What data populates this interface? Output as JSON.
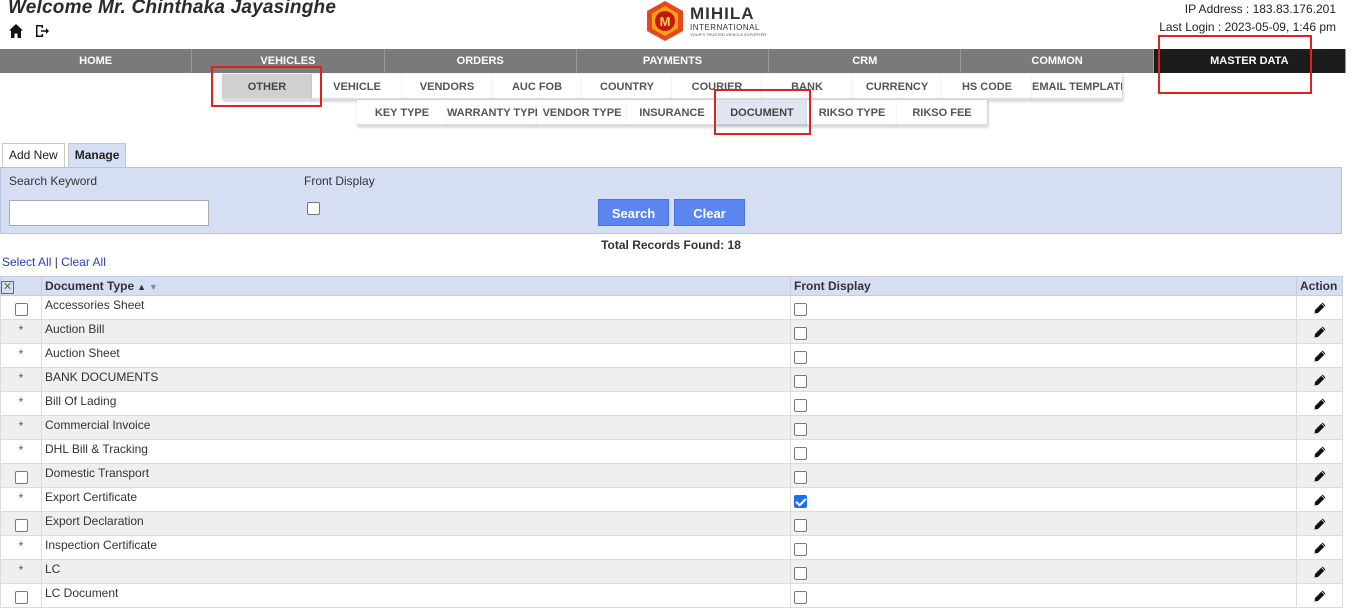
{
  "header": {
    "welcome": "Welcome Mr. Chinthaka Jayasinghe",
    "ip": "IP Address : 183.83.176.201",
    "last_login": "Last Login : 2023-05-09, 1:46 pm",
    "logo_name": "MIHILA",
    "logo_sub": "INTERNATIONAL",
    "logo_tag": "YOUR'S TRUSTED VEHICLE EXPORTER",
    "logo_letter": "M"
  },
  "mainnav": [
    "HOME",
    "VEHICLES",
    "ORDERS",
    "PAYMENTS",
    "CRM",
    "COMMON",
    "MASTER DATA"
  ],
  "subnav_row1": [
    "OTHER",
    "VEHICLE",
    "VENDORS",
    "AUC FOB",
    "COUNTRY",
    "COURIER",
    "BANK",
    "CURRENCY",
    "HS CODE",
    "EMAIL TEMPLATE"
  ],
  "subnav_row2": [
    "KEY TYPE",
    "WARRANTY TYPE",
    "VENDOR TYPE",
    "INSURANCE",
    "DOCUMENT",
    "RIKSO TYPE",
    "RIKSO FEE"
  ],
  "tabs": [
    "Add New",
    "Manage"
  ],
  "search": {
    "keyword_label": "Search Keyword",
    "front_display_label": "Front Display",
    "keyword_value": "",
    "search_button": "Search",
    "clear_button": "Clear"
  },
  "total_records": "Total Records Found: 18",
  "select_all": "Select All",
  "separator": "|",
  "clear_all": "Clear All",
  "table": {
    "headers": [
      "Document Type",
      "Front Display",
      "Action"
    ],
    "rows": [
      {
        "name": "Accessories Sheet",
        "marker": "checkbox",
        "front": false
      },
      {
        "name": "Auction Bill",
        "marker": "*",
        "front": false
      },
      {
        "name": "Auction Sheet",
        "marker": "*",
        "front": false
      },
      {
        "name": "BANK DOCUMENTS",
        "marker": "*",
        "front": false
      },
      {
        "name": "Bill Of Lading",
        "marker": "*",
        "front": false
      },
      {
        "name": "Commercial Invoice",
        "marker": "*",
        "front": false
      },
      {
        "name": "DHL Bill & Tracking",
        "marker": "*",
        "front": false
      },
      {
        "name": "Domestic Transport",
        "marker": "checkbox",
        "front": false
      },
      {
        "name": "Export Certificate",
        "marker": "*",
        "front": true
      },
      {
        "name": "Export Declaration",
        "marker": "checkbox",
        "front": false
      },
      {
        "name": "Inspection Certificate",
        "marker": "*",
        "front": false
      },
      {
        "name": "LC",
        "marker": "*",
        "front": false
      },
      {
        "name": "LC Document",
        "marker": "checkbox",
        "front": false
      }
    ]
  },
  "colors": {
    "nav_bg": "#7a7a7a",
    "nav_active": "#1c1c1c",
    "panel_bg": "#d6def4",
    "button": "#5b86f0",
    "highlight": "#e32020",
    "link": "#2b3ec4"
  }
}
